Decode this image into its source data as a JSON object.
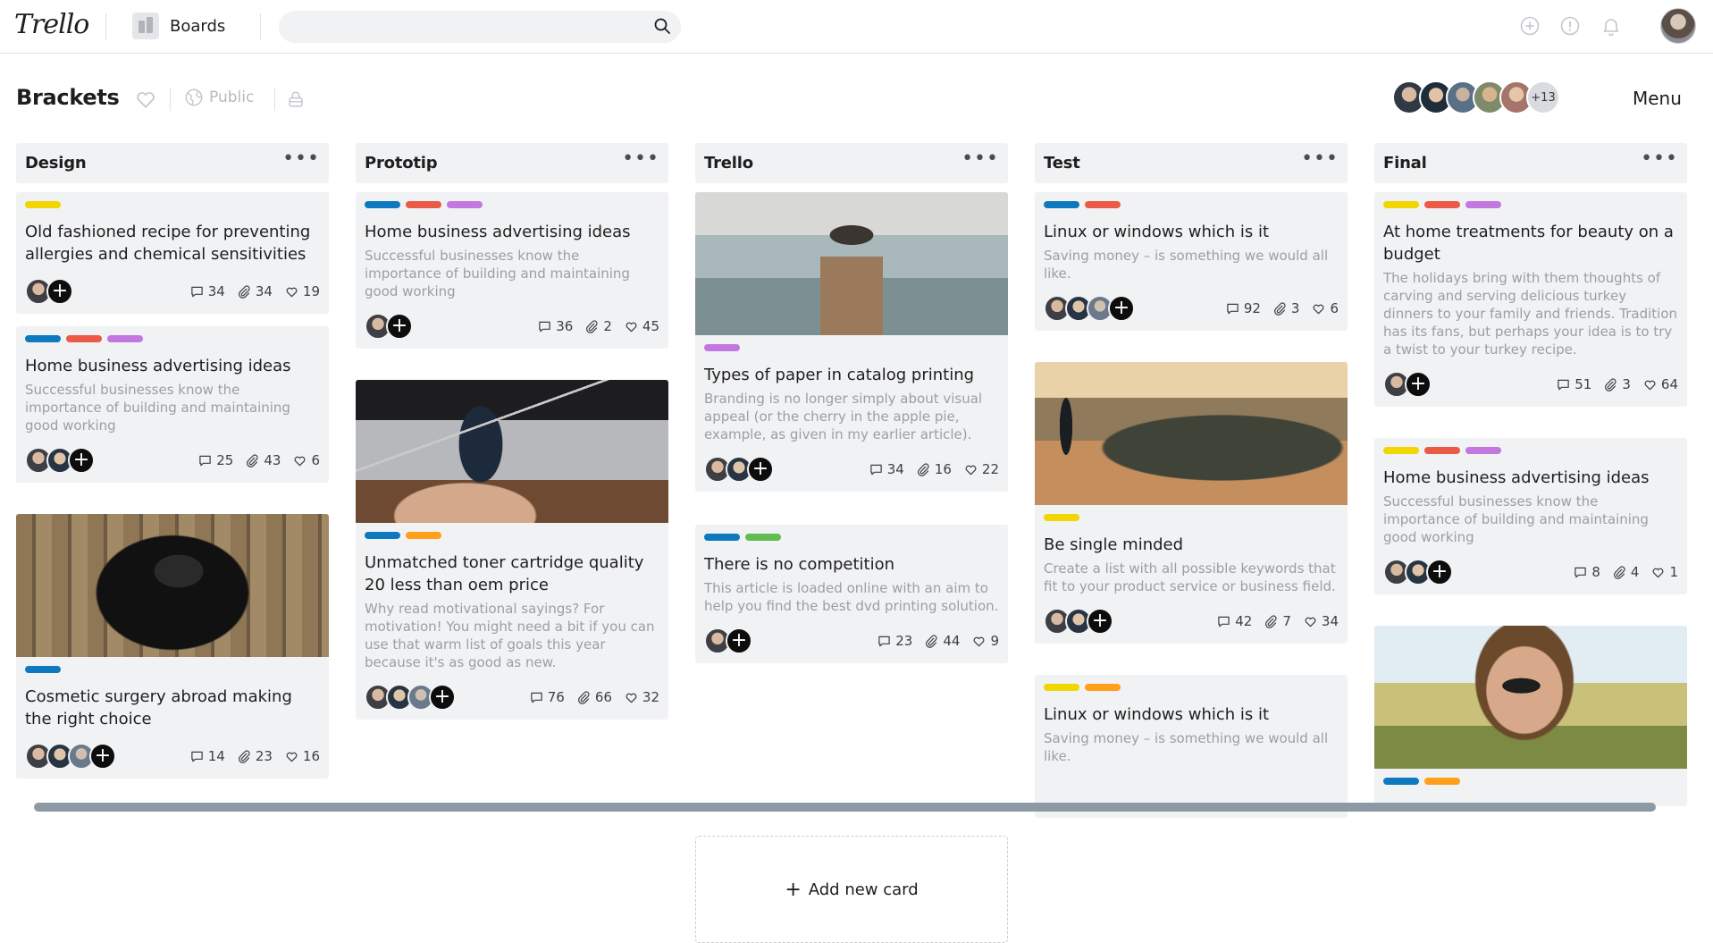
{
  "app": {
    "logo": "Trello"
  },
  "nav": {
    "boards_label": "Boards"
  },
  "search": {
    "placeholder": ""
  },
  "board": {
    "title": "Brackets",
    "visibility": "Public",
    "members_more": "+13",
    "menu_label": "Menu"
  },
  "colors": {
    "blue": "#0f79bf",
    "red": "#eb5a46",
    "purple": "#c377e0",
    "yellow": "#f2d600",
    "orange": "#ff9f1a",
    "green": "#61bd4f"
  },
  "lists": [
    {
      "title": "Design",
      "cards": [
        {
          "labels": [
            "yellow"
          ],
          "title": "Old fashioned recipe for preventing allergies and chemical sensitivities",
          "desc": "",
          "comments": "34",
          "attachments": "34",
          "likes": "19"
        },
        {
          "labels": [
            "blue",
            "red",
            "purple"
          ],
          "title": "Home business advertising ideas",
          "desc": "Successful businesses know the importance of building and maintaining good working",
          "comments": "25",
          "attachments": "43",
          "likes": "6"
        },
        {
          "image": "dog-photo",
          "labels": [
            "blue"
          ],
          "title": "Cosmetic surgery abroad making the right choice",
          "desc": "",
          "comments": "14",
          "attachments": "23",
          "likes": "16"
        }
      ]
    },
    {
      "title": "Prototip",
      "cards": [
        {
          "labels": [
            "blue",
            "red",
            "purple"
          ],
          "title": "Home business advertising ideas",
          "desc": "Successful businesses know the importance of building and maintaining good working",
          "comments": "36",
          "attachments": "2",
          "likes": "45"
        },
        {
          "image": "laptop-phone-photo",
          "labels": [
            "blue",
            "orange"
          ],
          "title": "Unmatched toner cartridge quality 20 less than oem price",
          "desc": "Why read motivational sayings? For motivation! You might need a bit if you can use that warm list of goals this year because it's as good as new.",
          "comments": "76",
          "attachments": "66",
          "likes": "32"
        }
      ]
    },
    {
      "title": "Trello",
      "cards": [
        {
          "image": "pier-photo",
          "labels": [
            "purple"
          ],
          "title": "Types of paper in catalog printing",
          "desc": "Branding is no longer simply about visual appeal (or the cherry in the apple pie, example, as given in my earlier article).",
          "comments": "34",
          "attachments": "16",
          "likes": "22"
        },
        {
          "labels": [
            "blue",
            "green"
          ],
          "title": "There is no competition",
          "desc": "This article is loaded online with an aim to help you find the best dvd printing solution.",
          "comments": "23",
          "attachments": "44",
          "likes": "9"
        }
      ],
      "add_card_label": "Add new card"
    },
    {
      "title": "Test",
      "cards": [
        {
          "labels": [
            "blue",
            "red"
          ],
          "title": "Linux or windows which is it",
          "desc": "Saving money – is something we would all like.",
          "comments": "92",
          "attachments": "3",
          "likes": "6"
        },
        {
          "image": "beach-sunset-photo",
          "labels": [
            "yellow"
          ],
          "title": "Be single minded",
          "desc": "Create a list with all possible keywords that fit to your product service or business field.",
          "comments": "42",
          "attachments": "7",
          "likes": "34"
        },
        {
          "labels": [
            "yellow",
            "orange"
          ],
          "title": "Linux or windows which is it",
          "desc": "Saving money – is something we would all like."
        }
      ]
    },
    {
      "title": "Final",
      "cards": [
        {
          "labels": [
            "yellow",
            "red",
            "purple"
          ],
          "title": "At home treatments for beauty on a budget",
          "desc": "The holidays bring with them thoughts of carving and serving delicious turkey dinners to your family and friends. Tradition has its fans, but perhaps your idea is to try a twist to your turkey recipe.",
          "comments": "51",
          "attachments": "3",
          "likes": "64"
        },
        {
          "labels": [
            "yellow",
            "red",
            "purple"
          ],
          "title": "Home business advertising ideas",
          "desc": "Successful businesses know the importance of building and maintaining good working",
          "comments": "8",
          "attachments": "4",
          "likes": "1"
        },
        {
          "image": "woman-sunglasses-photo",
          "labels": [
            "blue",
            "orange"
          ]
        }
      ]
    }
  ]
}
